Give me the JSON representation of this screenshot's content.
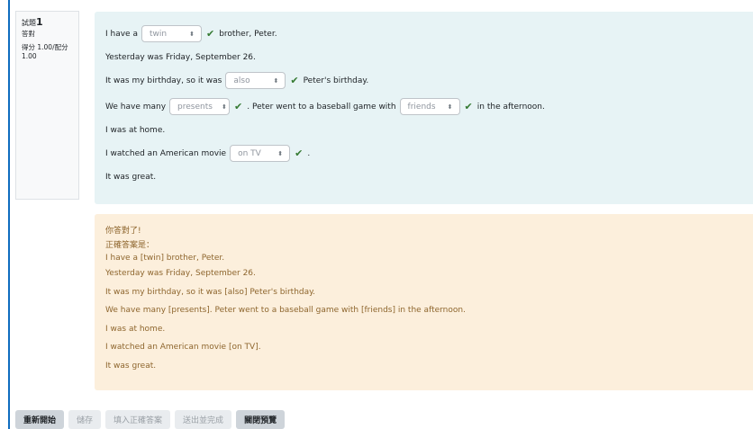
{
  "question_info": {
    "label": "試題",
    "number": "1",
    "state": "答對",
    "mark": "得分 1.00/配分 1.00"
  },
  "question": {
    "s1": {
      "before": "I have a",
      "choice": "twin",
      "after": "brother, Peter."
    },
    "s2": "Yesterday was Friday, September 26.",
    "s3": {
      "before": "It was my birthday, so it was",
      "choice": "also",
      "after": "Peter's birthday."
    },
    "s4": {
      "before": "We have many",
      "choice1": "presents",
      "middle": ". Peter went to a baseball game with",
      "choice2": "friends",
      "after": "in the afternoon."
    },
    "s5": "I was at home.",
    "s6": {
      "before": "I watched an American movie",
      "choice": "on TV",
      "after": "."
    },
    "s7": "It was great.",
    "check_glyph": "✔",
    "caret_glyph": "⬍"
  },
  "feedback": {
    "correct_msg": "你答對了!",
    "answer_header": "正確答案是：",
    "lines": [
      "I have a [twin] brother, Peter.",
      "Yesterday was Friday, September 26.",
      "It was my birthday, so it was [also] Peter's birthday.",
      "We have many [presents]. Peter went to a baseball game with [friends] in the afternoon.",
      "I was at home.",
      "I watched an American movie [on TV].",
      "It was great."
    ]
  },
  "buttons": {
    "restart": "重新開始",
    "save": "儲存",
    "fill_correct": "填入正確答案",
    "submit_finish": "送出並完成",
    "close_preview": "關閉預覽"
  },
  "colors": {
    "question_bg": "#e7f3f5",
    "feedback_bg": "#fcefdc",
    "feedback_text": "#8e662e",
    "check": "#357a32",
    "accent": "#0f6cbf"
  }
}
